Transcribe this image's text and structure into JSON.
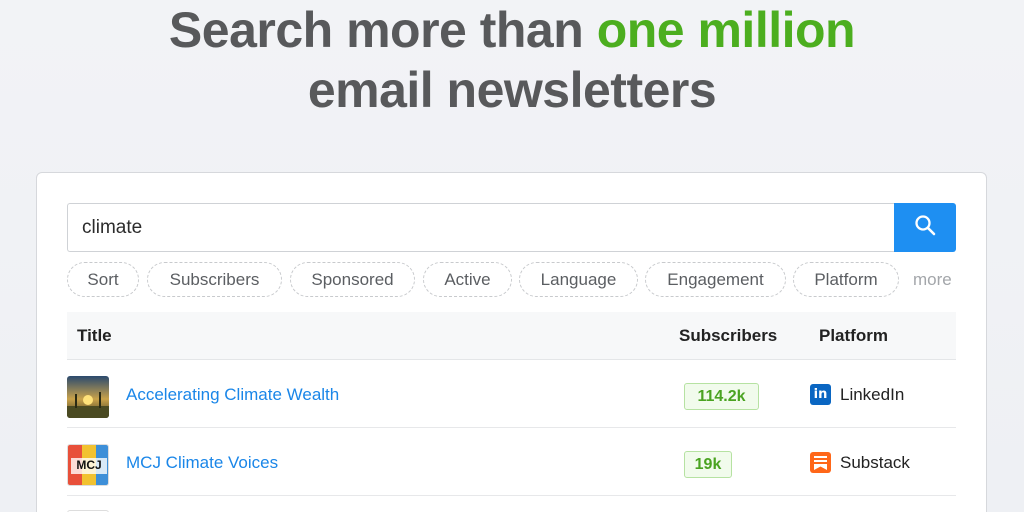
{
  "hero": {
    "prefix": "Search more than",
    "accent": "one million",
    "line2": "email newsletters"
  },
  "search": {
    "value": "climate",
    "button_icon": "search-icon"
  },
  "filters": [
    "Sort",
    "Subscribers",
    "Sponsored",
    "Active",
    "Language",
    "Engagement",
    "Platform"
  ],
  "more_label": "more",
  "table": {
    "columns": [
      "Title",
      "Subscribers",
      "Platform"
    ],
    "rows": [
      {
        "title": "Accelerating Climate Wealth",
        "subscribers": "114.2k",
        "platform": "LinkedIn",
        "platform_icon": "linkedin-icon"
      },
      {
        "title": "MCJ Climate Voices",
        "subscribers": "19k",
        "platform": "Substack",
        "platform_icon": "substack-icon",
        "thumb_text": "MCJ"
      }
    ]
  },
  "colors": {
    "accent_green": "#4cae1f",
    "primary_blue": "#1e8ff2",
    "link_blue": "#1a86e8",
    "linkedin": "#0a66c2",
    "substack": "#ff6719"
  }
}
